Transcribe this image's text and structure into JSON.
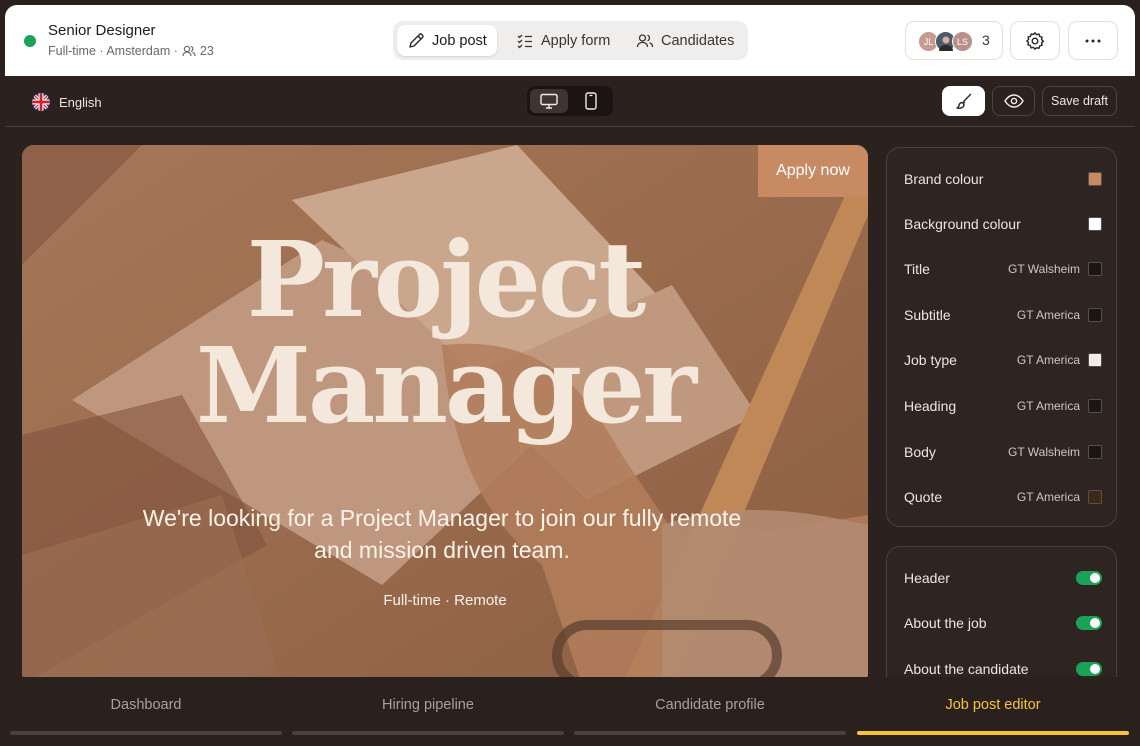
{
  "header": {
    "job_title": "Senior Designer",
    "job_meta": "Full-time · Amsterdam ·",
    "applicant_count": "23",
    "status_color": "#1aa257"
  },
  "tabs": [
    {
      "label": "Job post",
      "icon": "pencil-icon",
      "active": true
    },
    {
      "label": "Apply form",
      "icon": "checklist-icon",
      "active": false
    },
    {
      "label": "Candidates",
      "icon": "users-icon",
      "active": false
    }
  ],
  "collaborators": {
    "avatars": [
      "JL",
      "",
      "LS"
    ],
    "count": "3"
  },
  "editor_toolbar": {
    "language": "English",
    "save_draft": "Save draft"
  },
  "preview": {
    "apply_button": "Apply now",
    "title_line1": "Project",
    "title_line2": "Manager",
    "subtitle": "We're looking for a Project Manager to join our fully remote and mission driven team.",
    "meta": "Full-time · Remote",
    "brand_color": "#c88a63"
  },
  "style_settings": [
    {
      "label": "Brand colour",
      "font": "",
      "swatch": "#c88a63"
    },
    {
      "label": "Background colour",
      "font": "",
      "swatch": "#ffffff"
    },
    {
      "label": "Title",
      "font": "GT Walsheim",
      "swatch": "#1b1514"
    },
    {
      "label": "Subtitle",
      "font": "GT America",
      "swatch": "#1b1514"
    },
    {
      "label": "Job type",
      "font": "GT America",
      "swatch": "#f3ede9"
    },
    {
      "label": "Heading",
      "font": "GT America",
      "swatch": "#1b1514"
    },
    {
      "label": "Body",
      "font": "GT Walsheim",
      "swatch": "#1b1514"
    },
    {
      "label": "Quote",
      "font": "GT America",
      "swatch": "#3a2a16"
    }
  ],
  "sections": [
    {
      "label": "Header",
      "enabled": true
    },
    {
      "label": "About the job",
      "enabled": true
    },
    {
      "label": "About the candidate",
      "enabled": true
    }
  ],
  "bottom_nav": [
    {
      "label": "Dashboard",
      "active": false
    },
    {
      "label": "Hiring pipeline",
      "active": false
    },
    {
      "label": "Candidate profile",
      "active": false
    },
    {
      "label": "Job post editor",
      "active": true
    }
  ]
}
